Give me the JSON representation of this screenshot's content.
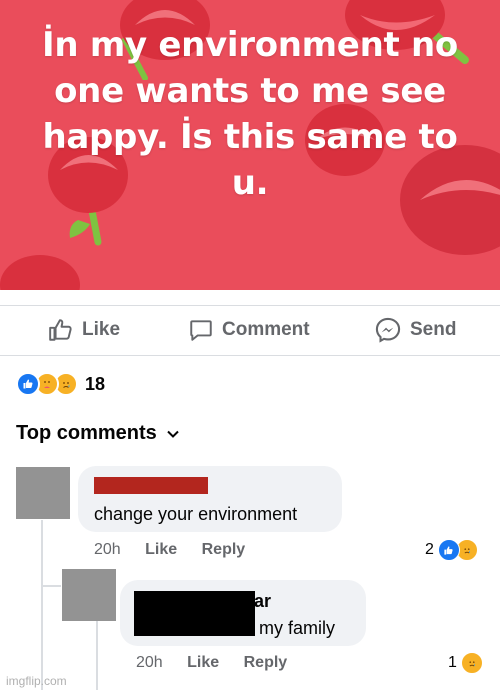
{
  "post": {
    "text_lines": [
      "İn my environment no",
      "one wants to me see",
      "happy. İs this same to",
      "u."
    ],
    "background_color": "#ea4d5b"
  },
  "actions": {
    "like": "Like",
    "comment": "Comment",
    "send": "Send"
  },
  "reactions": {
    "types": [
      "like-icon",
      "care-icon",
      "sad-icon"
    ],
    "count": "18"
  },
  "top_comments": {
    "label": "Top comments"
  },
  "comments": [
    {
      "text": "change your environment",
      "time": "20h",
      "like": "Like",
      "reply": "Reply",
      "reaction_count": "2",
      "reaction_icons": [
        "like-icon",
        "sad-icon"
      ]
    },
    {
      "name_fragment": "ar",
      "text_fragment": "r my family",
      "time": "20h",
      "like": "Like",
      "reply": "Reply",
      "reaction_count": "1",
      "reaction_icons": [
        "sad-icon"
      ]
    }
  ],
  "watermark": "imgflip.com",
  "colors": {
    "fb_blue": "#1877f2",
    "secondary_text": "#65676b",
    "bubble_bg": "#f0f2f5",
    "redaction_red": "#b3261e"
  }
}
